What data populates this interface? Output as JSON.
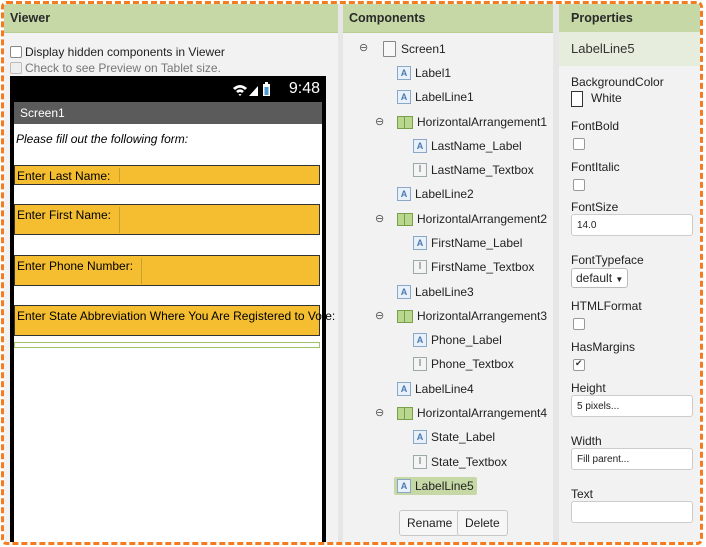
{
  "viewer": {
    "header": "Viewer",
    "display_hidden_label": "Display hidden components in Viewer",
    "tablet_preview_label": "Check to see Preview on Tablet size.",
    "phone": {
      "time": "9:48",
      "title": "Screen1",
      "intro_label": "Please fill out the following form:",
      "rows": [
        {
          "label": "Enter Last Name:"
        },
        {
          "label": "Enter First Name:"
        },
        {
          "label": "Enter Phone Number:"
        },
        {
          "label": "Enter State Abbreviation Where You Are Registered to Vote:"
        }
      ]
    }
  },
  "components": {
    "header": "Components",
    "tree": [
      {
        "name": "Screen1",
        "icon": "screen-icon"
      },
      {
        "name": "Label1",
        "icon": "label-icon"
      },
      {
        "name": "LabelLine1",
        "icon": "label-icon"
      },
      {
        "name": "HorizontalArrangement1",
        "icon": "arrangement-icon"
      },
      {
        "name": "LastName_Label",
        "icon": "label-icon"
      },
      {
        "name": "LastName_Textbox",
        "icon": "textbox-icon"
      },
      {
        "name": "LabelLine2",
        "icon": "label-icon"
      },
      {
        "name": "HorizontalArrangement2",
        "icon": "arrangement-icon"
      },
      {
        "name": "FirstName_Label",
        "icon": "label-icon"
      },
      {
        "name": "FirstName_Textbox",
        "icon": "textbox-icon"
      },
      {
        "name": "LabelLine3",
        "icon": "label-icon"
      },
      {
        "name": "HorizontalArrangement3",
        "icon": "arrangement-icon"
      },
      {
        "name": "Phone_Label",
        "icon": "label-icon"
      },
      {
        "name": "Phone_Textbox",
        "icon": "textbox-icon"
      },
      {
        "name": "LabelLine4",
        "icon": "label-icon"
      },
      {
        "name": "HorizontalArrangement4",
        "icon": "arrangement-icon"
      },
      {
        "name": "State_Label",
        "icon": "label-icon"
      },
      {
        "name": "State_Textbox",
        "icon": "textbox-icon"
      },
      {
        "name": "LabelLine5",
        "icon": "label-icon",
        "selected": true
      }
    ],
    "rename_label": "Rename",
    "delete_label": "Delete"
  },
  "properties": {
    "header": "Properties",
    "component": "LabelLine5",
    "background_color_label": "BackgroundColor",
    "background_color_value": "White",
    "font_bold_label": "FontBold",
    "font_italic_label": "FontItalic",
    "font_size_label": "FontSize",
    "font_size_value": "14.0",
    "font_typeface_label": "FontTypeface",
    "font_typeface_value": "default",
    "html_format_label": "HTMLFormat",
    "has_margins_label": "HasMargins",
    "height_label": "Height",
    "height_value": "5 pixels...",
    "width_label": "Width",
    "width_value": "Fill parent...",
    "text_label": "Text",
    "text_value": ""
  },
  "colors": {
    "header_bg": "#c5d8a5",
    "arrangement_fill": "#f4be30",
    "frame_dash": "#f47b20"
  }
}
